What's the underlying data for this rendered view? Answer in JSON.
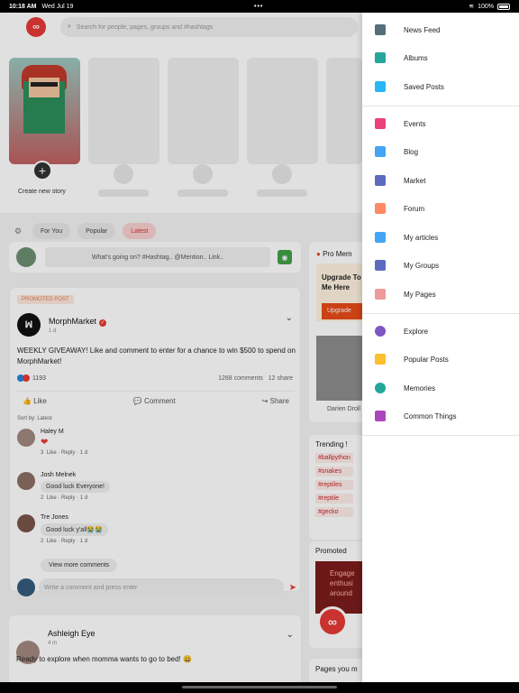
{
  "status": {
    "time": "10:18 AM",
    "date": "Wed Jul 19",
    "battery": "100%"
  },
  "header": {
    "logo": "∞",
    "search_placeholder": "Search for people, pages, groups and #hashtags"
  },
  "stories": {
    "create_label": "Create new story"
  },
  "filters": [
    "For You",
    "Popular",
    "Latest"
  ],
  "composer": {
    "placeholder": "What's going on? #Hashtag.. @Mention.. Link.."
  },
  "post1": {
    "badge": "PROMOTED POST",
    "author": "MorphMarket",
    "logo_text": "ꟽ",
    "time": "1 d",
    "text": "WEEKLY GIVEAWAY! Like and comment to enter for a chance to win $500 to spend on MorphMarket!",
    "reactions": "1193",
    "comments_count": "1268 comments",
    "shares_count": "12 share",
    "like": "Like",
    "comment": "Comment",
    "share": "Share",
    "sort": "Sort by: Latest",
    "comments": [
      {
        "name": "Haley M",
        "text": "❤",
        "meta": "Like · Reply · 1 d",
        "likes": "3"
      },
      {
        "name": "Josh Melnek",
        "text": "Good luck Everyone!",
        "meta": "Like · Reply · 1 d",
        "likes": "2"
      },
      {
        "name": "Tre Jones",
        "text": "Good luck y'all😭😭",
        "meta": "Like · Reply · 1 d",
        "likes": "2"
      }
    ],
    "view_more": "View more comments",
    "comment_placeholder": "Write a comment and press enter"
  },
  "post2": {
    "author": "Ashleigh Eye",
    "time": "4 m",
    "text": "Ready to explore when momma wants to go to bed! 😀"
  },
  "sidebar": {
    "pro_title": "Pro Mem",
    "upgrade_title": "Upgrade To Me Here",
    "upgrade_button": "Upgrade",
    "member_name": "Darien Droll",
    "trending_title": "Trending !",
    "hashtags": [
      "#ballpython",
      "#snakes",
      "#reptiles",
      "#reptile",
      "#gecko"
    ],
    "promoted_title": "Promoted",
    "promoted_text": "Engage enthusi around",
    "pages_title": "Pages you m"
  },
  "drawer": [
    {
      "label": "News Feed",
      "icon": "news-feed-icon",
      "color": "#546e7a"
    },
    {
      "label": "Albums",
      "icon": "albums-icon",
      "color": "#26a69a"
    },
    {
      "label": "Saved Posts",
      "icon": "bookmark-icon",
      "color": "#29b6f6"
    },
    {
      "label": "Events",
      "icon": "calendar-icon",
      "color": "#ec407a"
    },
    {
      "label": "Blog",
      "icon": "blog-icon",
      "color": "#42a5f5"
    },
    {
      "label": "Market",
      "icon": "market-icon",
      "color": "#5c6bc0"
    },
    {
      "label": "Forum",
      "icon": "forum-icon",
      "color": "#ff8a65"
    },
    {
      "label": "My articles",
      "icon": "articles-icon",
      "color": "#42a5f5"
    },
    {
      "label": "My Groups",
      "icon": "groups-icon",
      "color": "#5c6bc0"
    },
    {
      "label": "My Pages",
      "icon": "flag-icon",
      "color": "#ef9a9a"
    },
    {
      "label": "Explore",
      "icon": "compass-icon",
      "color": "#7e57c2"
    },
    {
      "label": "Popular Posts",
      "icon": "popular-icon",
      "color": "#fbc02d"
    },
    {
      "label": "Memories",
      "icon": "memories-icon",
      "color": "#26a69a"
    },
    {
      "label": "Common Things",
      "icon": "common-things-icon",
      "color": "#ab47bc"
    }
  ]
}
